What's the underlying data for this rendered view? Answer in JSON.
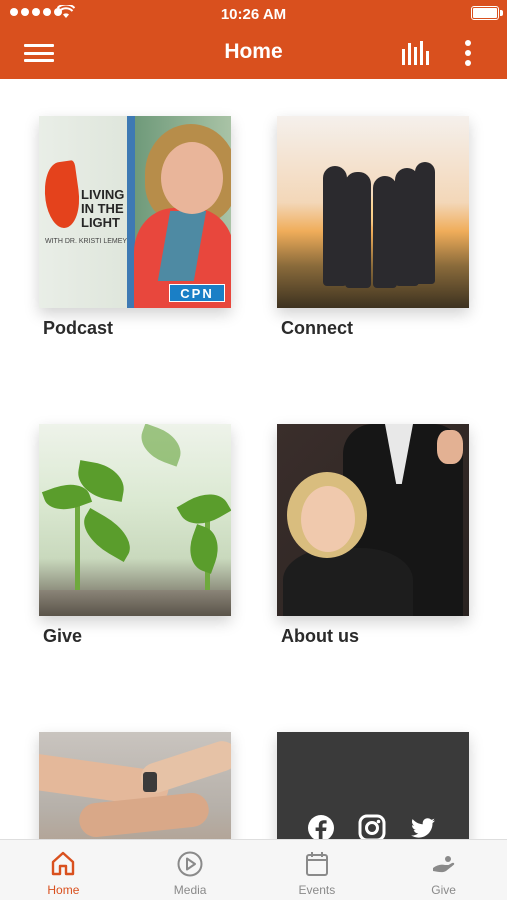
{
  "status_bar": {
    "time": "10:26 AM"
  },
  "header": {
    "title": "Home"
  },
  "tiles": [
    {
      "label": "Podcast",
      "image_text": {
        "title": "LIVING IN THE LIGHT",
        "subtitle": "WITH DR. KRISTI LEMEY",
        "badge": "CPN"
      }
    },
    {
      "label": "Connect"
    },
    {
      "label": "Give"
    },
    {
      "label": "About us"
    },
    {
      "label": ""
    },
    {
      "label": ""
    }
  ],
  "social_icons": [
    "facebook-icon",
    "instagram-icon",
    "twitter-icon"
  ],
  "tabs": [
    {
      "label": "Home",
      "icon": "home-icon",
      "active": true
    },
    {
      "label": "Media",
      "icon": "play-circle-icon",
      "active": false
    },
    {
      "label": "Events",
      "icon": "calendar-icon",
      "active": false
    },
    {
      "label": "Give",
      "icon": "give-hand-icon",
      "active": false
    }
  ],
  "colors": {
    "accent": "#d9501e",
    "tab_inactive": "#8a8a8a",
    "tile_label": "#2b2b2b"
  }
}
